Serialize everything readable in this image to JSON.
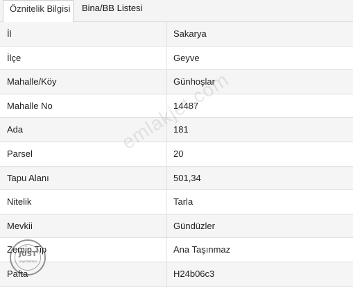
{
  "tabs": [
    {
      "label": "Öznitelik Bilgisi",
      "active": true
    },
    {
      "label": "Bina/BB Listesi",
      "active": false
    }
  ],
  "rows": [
    {
      "label": "İl",
      "value": "Sakarya"
    },
    {
      "label": "İlçe",
      "value": "Geyve"
    },
    {
      "label": "Mahalle/Köy",
      "value": "Günhoşlar"
    },
    {
      "label": "Mahalle No",
      "value": "14487"
    },
    {
      "label": "Ada",
      "value": "181"
    },
    {
      "label": "Parsel",
      "value": "20"
    },
    {
      "label": "Tapu Alanı",
      "value": "501,34"
    },
    {
      "label": "Nitelik",
      "value": "Tarla"
    },
    {
      "label": "Mevkii",
      "value": "Gündüzler"
    },
    {
      "label": "Zemin Tip",
      "value": "Ana Taşınmaz"
    },
    {
      "label": "Pafta",
      "value": "H24b06c3"
    }
  ],
  "watermark": "emlakjet.com",
  "stamp": {
    "line1": "JUST",
    "line2": "Gayrimenkul"
  }
}
